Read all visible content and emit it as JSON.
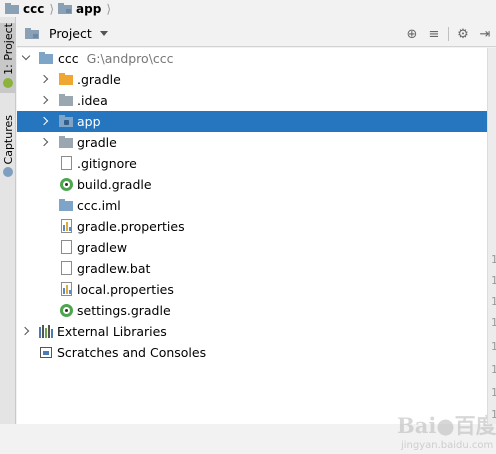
{
  "breadcrumb": {
    "items": [
      {
        "label": "ccc",
        "icon": "folder-icon"
      },
      {
        "label": "app",
        "icon": "module-folder-icon"
      }
    ],
    "separator": "⟩"
  },
  "tool_strip": {
    "tabs": [
      {
        "label": "1: Project",
        "icon": "android-icon",
        "active": true
      },
      {
        "label": "Captures",
        "icon": "captures-icon",
        "active": false
      }
    ]
  },
  "project_header": {
    "view_label": "Project",
    "tools": [
      {
        "name": "locate-icon",
        "glyph": "⊕"
      },
      {
        "name": "collapse-all-icon",
        "glyph": "≡"
      },
      {
        "name": "settings-gear-icon",
        "glyph": "⚙"
      },
      {
        "name": "hide-panel-icon",
        "glyph": "⇥"
      }
    ]
  },
  "tree": {
    "root": {
      "label": "ccc",
      "path": "G:\\andpro\\ccc"
    },
    "items": [
      {
        "label": ".gradle",
        "type": "folder-orange",
        "expandable": true
      },
      {
        "label": ".idea",
        "type": "folder-grey",
        "expandable": true
      },
      {
        "label": "app",
        "type": "folder-module",
        "expandable": true,
        "selected": true
      },
      {
        "label": "gradle",
        "type": "folder-grey",
        "expandable": true
      },
      {
        "label": ".gitignore",
        "type": "file-text",
        "expandable": false
      },
      {
        "label": "build.gradle",
        "type": "gradle",
        "expandable": false
      },
      {
        "label": "ccc.iml",
        "type": "folder-module-small",
        "expandable": false
      },
      {
        "label": "gradle.properties",
        "type": "file-properties",
        "expandable": false
      },
      {
        "label": "gradlew",
        "type": "file-text",
        "expandable": false
      },
      {
        "label": "gradlew.bat",
        "type": "file-text",
        "expandable": false
      },
      {
        "label": "local.properties",
        "type": "file-properties",
        "expandable": false
      },
      {
        "label": "settings.gradle",
        "type": "gradle",
        "expandable": false
      }
    ],
    "external_libraries": "External Libraries",
    "scratches": "Scratches and Consoles"
  },
  "gutter": {
    "line_numbers": [
      "1",
      "1",
      "1",
      "1",
      "1",
      "1",
      "1",
      "1"
    ]
  },
  "watermark": {
    "text": "Bai●百度",
    "sub": "jingyan.baidu.com"
  },
  "colors": {
    "selection": "#2675bf",
    "background": "#ffffff",
    "gradle_green": "#4ca64c",
    "folder_orange": "#f0a732"
  }
}
